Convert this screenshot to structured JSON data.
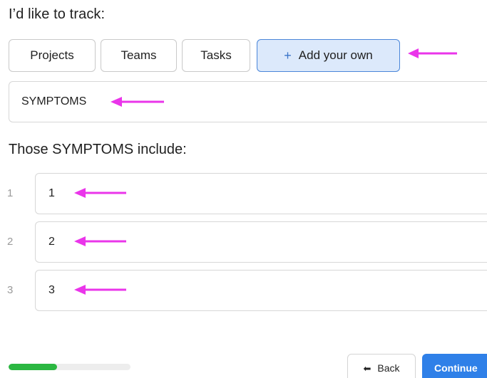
{
  "heading": "I’d like to track:",
  "chips": {
    "projects": "Projects",
    "teams": "Teams",
    "tasks": "Tasks",
    "add_own": "Add your own",
    "add_icon": "plus-icon"
  },
  "topic": {
    "value": "SYMPTOMS"
  },
  "subheading": "Those SYMPTOMS include:",
  "items": [
    {
      "number": "1",
      "value": "1"
    },
    {
      "number": "2",
      "value": "2"
    },
    {
      "number": "3",
      "value": "3"
    }
  ],
  "annotations": {
    "arrow_color": "#ea35ea",
    "arrow_icon": "left-arrow-icon"
  },
  "progress": {
    "fraction": 0.4,
    "color": "#2bb741"
  },
  "buttons": {
    "back_label": "Back",
    "back_icon": "left-arrow-icon",
    "continue_label": "Continue"
  },
  "colors": {
    "selected_chip_bg": "#dce9fb",
    "selected_chip_border": "#4a86d9",
    "continue_bg": "#2f80e8"
  }
}
